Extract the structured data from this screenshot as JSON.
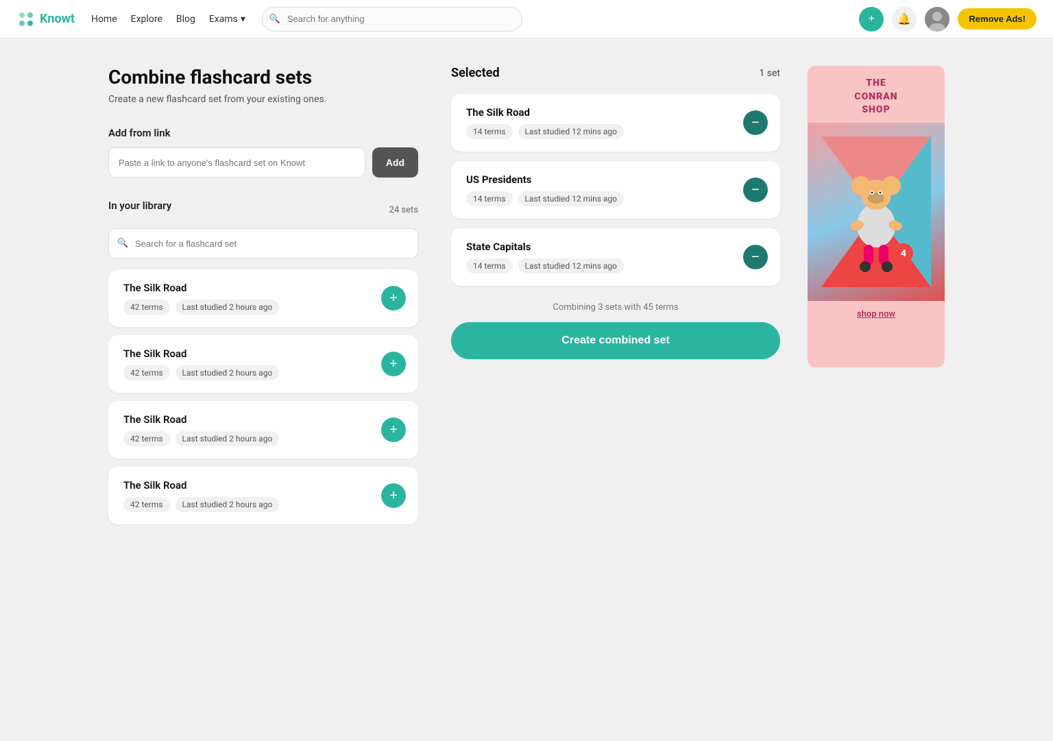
{
  "nav": {
    "logo": "Knowt",
    "links": [
      "Home",
      "Explore",
      "Blog",
      "Exams"
    ],
    "search_placeholder": "Search for anything",
    "add_label": "+",
    "remove_ads_label": "Remove Ads!"
  },
  "page": {
    "title": "Combine flashcard sets",
    "subtitle": "Create a new flashcard set from your existing ones."
  },
  "add_from_link": {
    "label": "Add from link",
    "input_placeholder": "Paste a link to anyone's flashcard set on Knowt",
    "button_label": "Add"
  },
  "library": {
    "label": "In your library",
    "count": "24 sets",
    "search_placeholder": "Search for a flashcard set",
    "cards": [
      {
        "title": "The Silk Road",
        "terms": "42 terms",
        "last_studied": "Last studied 2 hours ago"
      },
      {
        "title": "The Silk Road",
        "terms": "42 terms",
        "last_studied": "Last studied 2 hours ago"
      },
      {
        "title": "The Silk Road",
        "terms": "42 terms",
        "last_studied": "Last studied 2 hours ago"
      },
      {
        "title": "The Silk Road",
        "terms": "42 terms",
        "last_studied": "Last studied 2 hours ago"
      }
    ]
  },
  "selected": {
    "label": "Selected",
    "count": "1 set",
    "cards": [
      {
        "title": "The Silk Road",
        "terms": "14 terms",
        "last_studied": "Last studied 12 mins ago"
      },
      {
        "title": "US Presidents",
        "terms": "14 terms",
        "last_studied": "Last studied 12 mins ago"
      },
      {
        "title": "State Capitals",
        "terms": "14 terms",
        "last_studied": "Last studied 12 mins ago"
      }
    ],
    "combine_info": "Combining 3 sets with 45 terms",
    "create_button_label": "Create combined set"
  },
  "ad": {
    "brand_line1": "THE",
    "brand_line2": "CONRAN",
    "brand_line3": "SHOP",
    "cta": "shop now"
  }
}
